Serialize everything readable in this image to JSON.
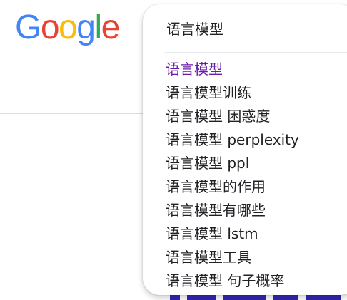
{
  "logo": {
    "letters": [
      "G",
      "o",
      "o",
      "g",
      "l",
      "e"
    ],
    "colors": [
      "#4285F4",
      "#EA4335",
      "#FBBC05",
      "#4285F4",
      "#34A853",
      "#EA4335"
    ]
  },
  "search": {
    "value": "语言模型"
  },
  "suggestions": [
    "语言模型",
    "语言模型训练",
    "语言模型 困惑度",
    "语言模型 perplexity",
    "语言模型 ppl",
    "语言模型的作用",
    "语言模型有哪些",
    "语言模型 lstm",
    "语言模型工具",
    "语言模型 句子概率"
  ],
  "colors": {
    "text": "#202124",
    "visited_suggestion": "#681da8",
    "divider": "#dadce0"
  }
}
